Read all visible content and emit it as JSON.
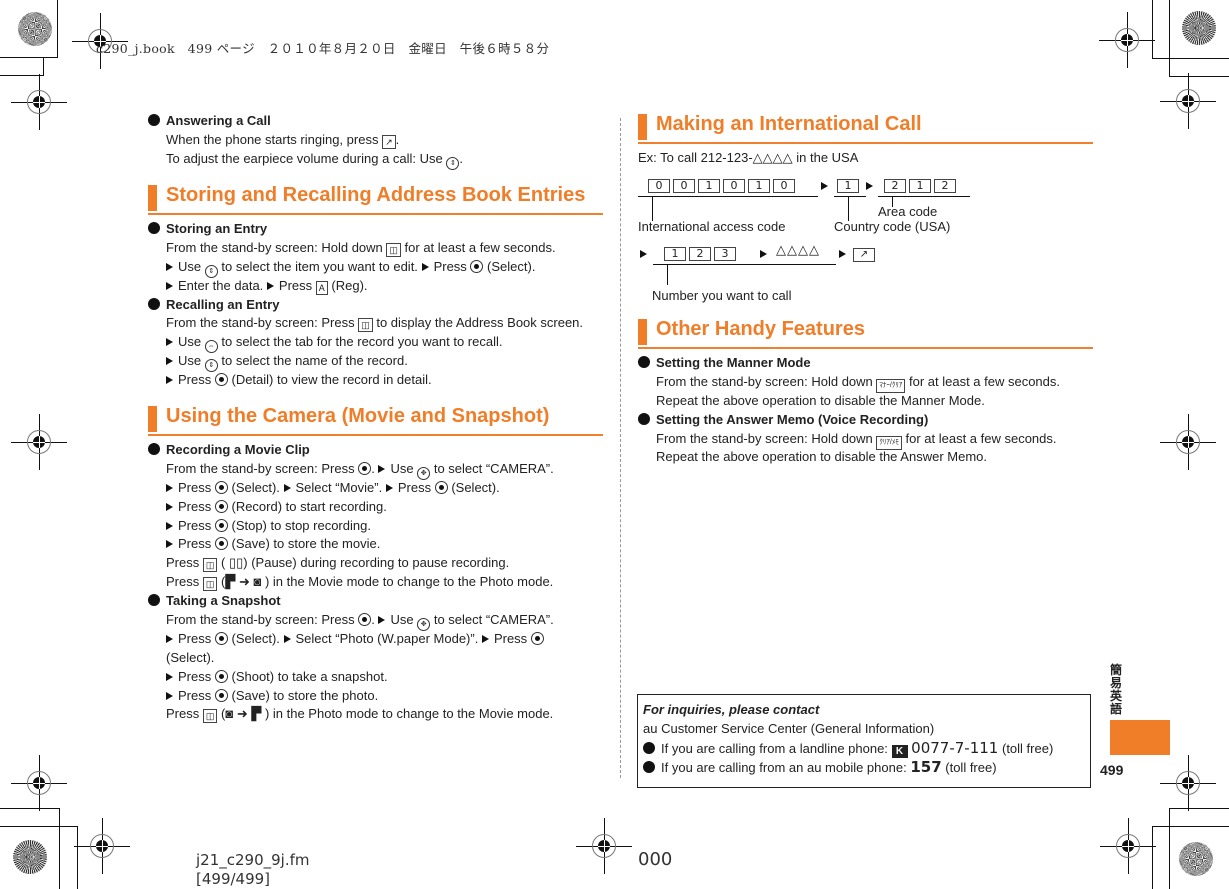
{
  "header": {
    "print_info": "c290_j.book　499 ページ　２０１０年８月２０日　金曜日　午後６時５８分"
  },
  "left_column": {
    "answering": {
      "title": "Answering a Call",
      "line1_a": "When the phone starts ringing, press",
      "line1_b": ".",
      "line2_a": "To adjust the earpiece volume during a call: Use",
      "line2_b": "."
    },
    "address_book": {
      "section_title": "Storing and Recalling Address Book Entries",
      "storing": {
        "title": "Storing an Entry",
        "l1_a": "From the stand-by screen: Hold down",
        "l1_b": "for at least a few seconds.",
        "l2_a": "Use",
        "l2_b": "to select the item you want to edit.",
        "l2_c": "Press",
        "l2_d": "(Select).",
        "l3_a": "Enter the data.",
        "l3_b": "Press",
        "l3_c": "(Reg)."
      },
      "recalling": {
        "title": "Recalling an Entry",
        "l1_a": "From the stand-by screen: Press",
        "l1_b": "to display the Address Book screen.",
        "l2_a": "Use",
        "l2_b": "to select the tab for the record you want to recall.",
        "l3_a": "Use",
        "l3_b": "to select the name of the record.",
        "l4_a": "Press",
        "l4_b": "(Detail) to view the record in detail."
      }
    },
    "camera": {
      "section_title": "Using the Camera (Movie and Snapshot)",
      "movie": {
        "title": "Recording a Movie Clip",
        "l1_a": "From the stand-by screen: Press",
        "l1_b": ".",
        "l1_c": "Use",
        "l1_d": "to select “CAMERA”.",
        "l2_a": "Press",
        "l2_b": "(Select).",
        "l2_c": "Select “Movie”.",
        "l2_d": "Press",
        "l2_e": "(Select).",
        "l3_a": "Press",
        "l3_b": "(Record) to start recording.",
        "l4_a": "Press",
        "l4_b": "(Stop) to stop recording.",
        "l5_a": "Press",
        "l5_b": "(Save) to store the movie.",
        "l6_a": "Press",
        "l6_b": "(",
        "l6_c": ") (Pause) during recording to pause recording.",
        "l7_a": "Press",
        "l7_b": "(",
        "l7_c": ") in the Movie mode to change to the Photo mode."
      },
      "snapshot": {
        "title": "Taking a Snapshot",
        "l1_a": "From the stand-by screen: Press",
        "l1_b": ".",
        "l1_c": "Use",
        "l1_d": "to select “CAMERA”.",
        "l2_a": "Press",
        "l2_b": "(Select).",
        "l2_c": "Select “Photo (W.paper Mode)”.",
        "l2_d": "Press",
        "l3": "(Select).",
        "l4_a": "Press",
        "l4_b": "(Shoot) to take a snapshot.",
        "l5_a": "Press",
        "l5_b": "(Save) to store the photo.",
        "l6_a": "Press",
        "l6_b": "(",
        "l6_c": ") in the Photo mode to change to the Movie mode."
      }
    }
  },
  "right_column": {
    "intl": {
      "section_title": "Making an International Call",
      "example": "Ex: To call 212-123-△△△△ in the USA",
      "access_digits": [
        "0",
        "0",
        "1",
        "0",
        "1",
        "0"
      ],
      "country_digits": [
        "1"
      ],
      "area_digits": [
        "2",
        "1",
        "2"
      ],
      "number_digits": [
        "1",
        "2",
        "3"
      ],
      "placeholder_digits": "△△△△",
      "label_access": "International access code",
      "label_country": "Country code (USA)",
      "label_area": "Area code",
      "label_number": "Number you want to call"
    },
    "handy": {
      "section_title": "Other Handy Features",
      "manner": {
        "title": "Setting the Manner Mode",
        "l1_a": "From the stand-by screen: Hold down",
        "l1_key": "ﾏﾅｰ/ｸﾘｱ",
        "l1_b": "for at least a few seconds.",
        "l2": "Repeat the above operation to disable the Manner Mode."
      },
      "memo": {
        "title": "Setting the Answer Memo (Voice Recording)",
        "l1_a": "From the stand-by screen: Hold down",
        "l1_key": "ｸﾘｱ/ﾒﾓ",
        "l1_b": "for at least a few seconds.",
        "l2": "Repeat the above operation to disable the Answer Memo."
      }
    },
    "contact": {
      "title": "For inquiries, please contact",
      "center": "au Customer Service Center (General Information)",
      "landline_text": "If you are calling from a landline phone:",
      "landline_number": "0077-7-111",
      "landline_note": "(toll free)",
      "mobile_text": "If you are calling from an au mobile phone:",
      "mobile_number": "157",
      "mobile_note": "(toll free)"
    }
  },
  "side": {
    "label": "簡易英語",
    "page_number": "499",
    "accent_color": "#f07d28"
  },
  "footer": {
    "file": "j21_c290_9j.fm",
    "pages": "[499/499]",
    "code": "000"
  }
}
